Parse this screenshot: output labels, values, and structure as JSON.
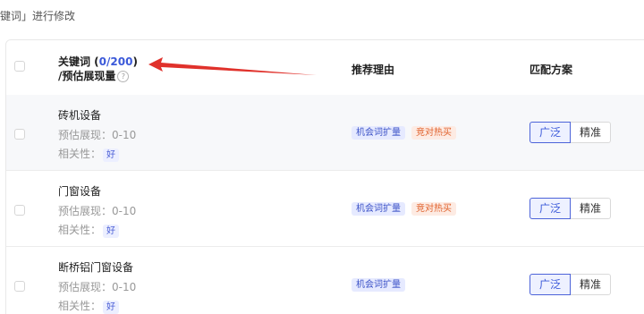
{
  "hint_text": "键词」进行修改",
  "header": {
    "keyword_prefix": "关键词 (",
    "keyword_count": "0/200",
    "keyword_suffix": ")",
    "keyword_line2": "/预估展现量",
    "help_glyph": "?",
    "reason": "推荐理由",
    "match": "匹配方案"
  },
  "rows": [
    {
      "keyword": "砖机设备",
      "estimate": "预估展现：0-10",
      "relevance_label": "相关性：",
      "relevance_value": "好",
      "tags": [
        "机会词扩量",
        "竞对热买"
      ],
      "match_options": [
        "广泛",
        "精准"
      ],
      "selected_match": "广泛"
    },
    {
      "keyword": "门窗设备",
      "estimate": "预估展现：0-10",
      "relevance_label": "相关性：",
      "relevance_value": "好",
      "tags": [
        "机会词扩量",
        "竞对热买"
      ],
      "match_options": [
        "广泛",
        "精准"
      ],
      "selected_match": "广泛"
    },
    {
      "keyword": "断桥铝门窗设备",
      "estimate": "预估展现：0-10",
      "relevance_label": "相关性：",
      "relevance_value": "好",
      "tags": [
        "机会词扩量"
      ],
      "match_options": [
        "广泛",
        "精准"
      ],
      "selected_match": "广泛"
    }
  ],
  "colors": {
    "annotation_arrow": "#e0312b",
    "accent": "#3b59d9"
  }
}
